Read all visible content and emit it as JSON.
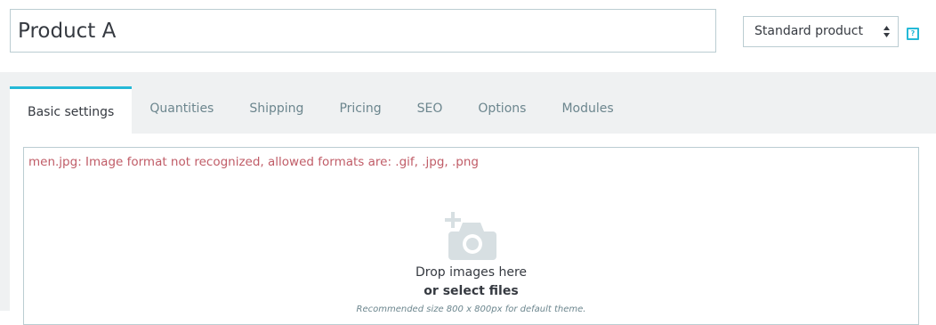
{
  "header": {
    "product_name": "Product A",
    "product_type": "Standard product",
    "help_label": "?"
  },
  "tabs": [
    {
      "label": "Basic settings",
      "active": true
    },
    {
      "label": "Quantities",
      "active": false
    },
    {
      "label": "Shipping",
      "active": false
    },
    {
      "label": "Pricing",
      "active": false
    },
    {
      "label": "SEO",
      "active": false
    },
    {
      "label": "Options",
      "active": false
    },
    {
      "label": "Modules",
      "active": false
    }
  ],
  "images": {
    "error": "men.jpg: Image format not recognized, allowed formats are: .gif, .jpg, .png",
    "drop_text": "Drop images here",
    "select_files": "or select files",
    "hint": "Recommended size 800 x 800px for default theme.",
    "icon": "add-photo-icon"
  },
  "colors": {
    "accent": "#25b9d7",
    "error": "#c05c67",
    "border": "#bbcdd2",
    "background": "#eff1f2",
    "text": "#363a41",
    "muted": "#6c868e"
  }
}
